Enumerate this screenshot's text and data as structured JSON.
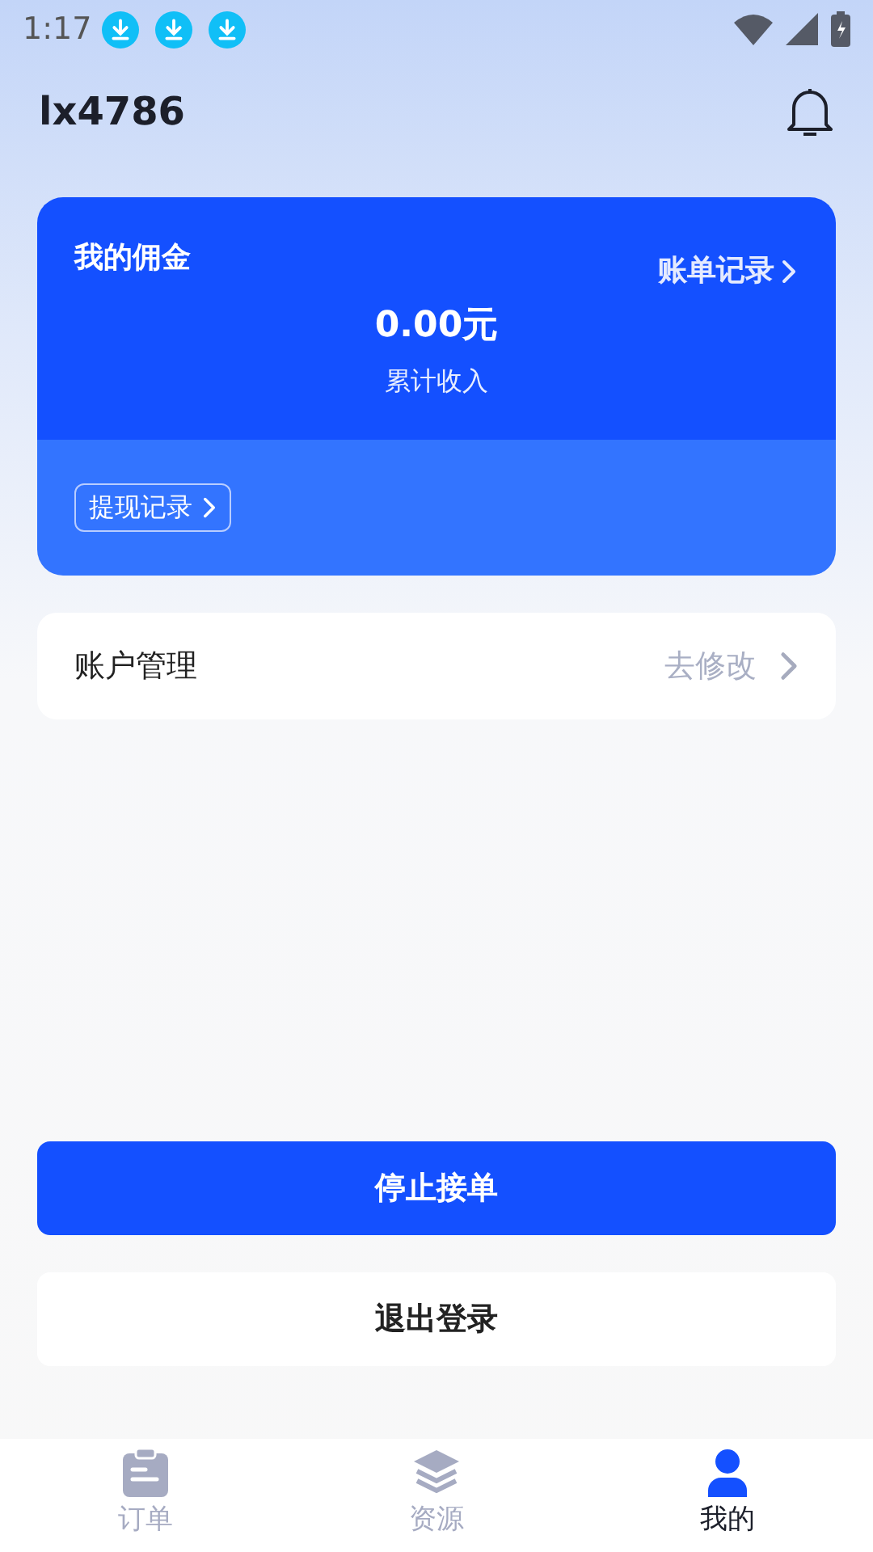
{
  "status_bar": {
    "time": "1:17",
    "notifications": [
      {
        "kind": "download"
      },
      {
        "kind": "download"
      },
      {
        "kind": "download"
      }
    ]
  },
  "header": {
    "username": "lx4786"
  },
  "commission_card": {
    "title": "我的佣金",
    "bill_link": "账单记录",
    "amount": "0.00元",
    "amount_label": "累计收入",
    "withdraw_link": "提现记录"
  },
  "account_row": {
    "label": "账户管理",
    "action": "去修改"
  },
  "buttons": {
    "stop": "停止接单",
    "logout": "退出登录"
  },
  "tabs": [
    {
      "label": "订单",
      "kind": "orders",
      "selected": false
    },
    {
      "label": "资源",
      "kind": "resources",
      "selected": false
    },
    {
      "label": "我的",
      "kind": "me",
      "selected": true
    }
  ]
}
